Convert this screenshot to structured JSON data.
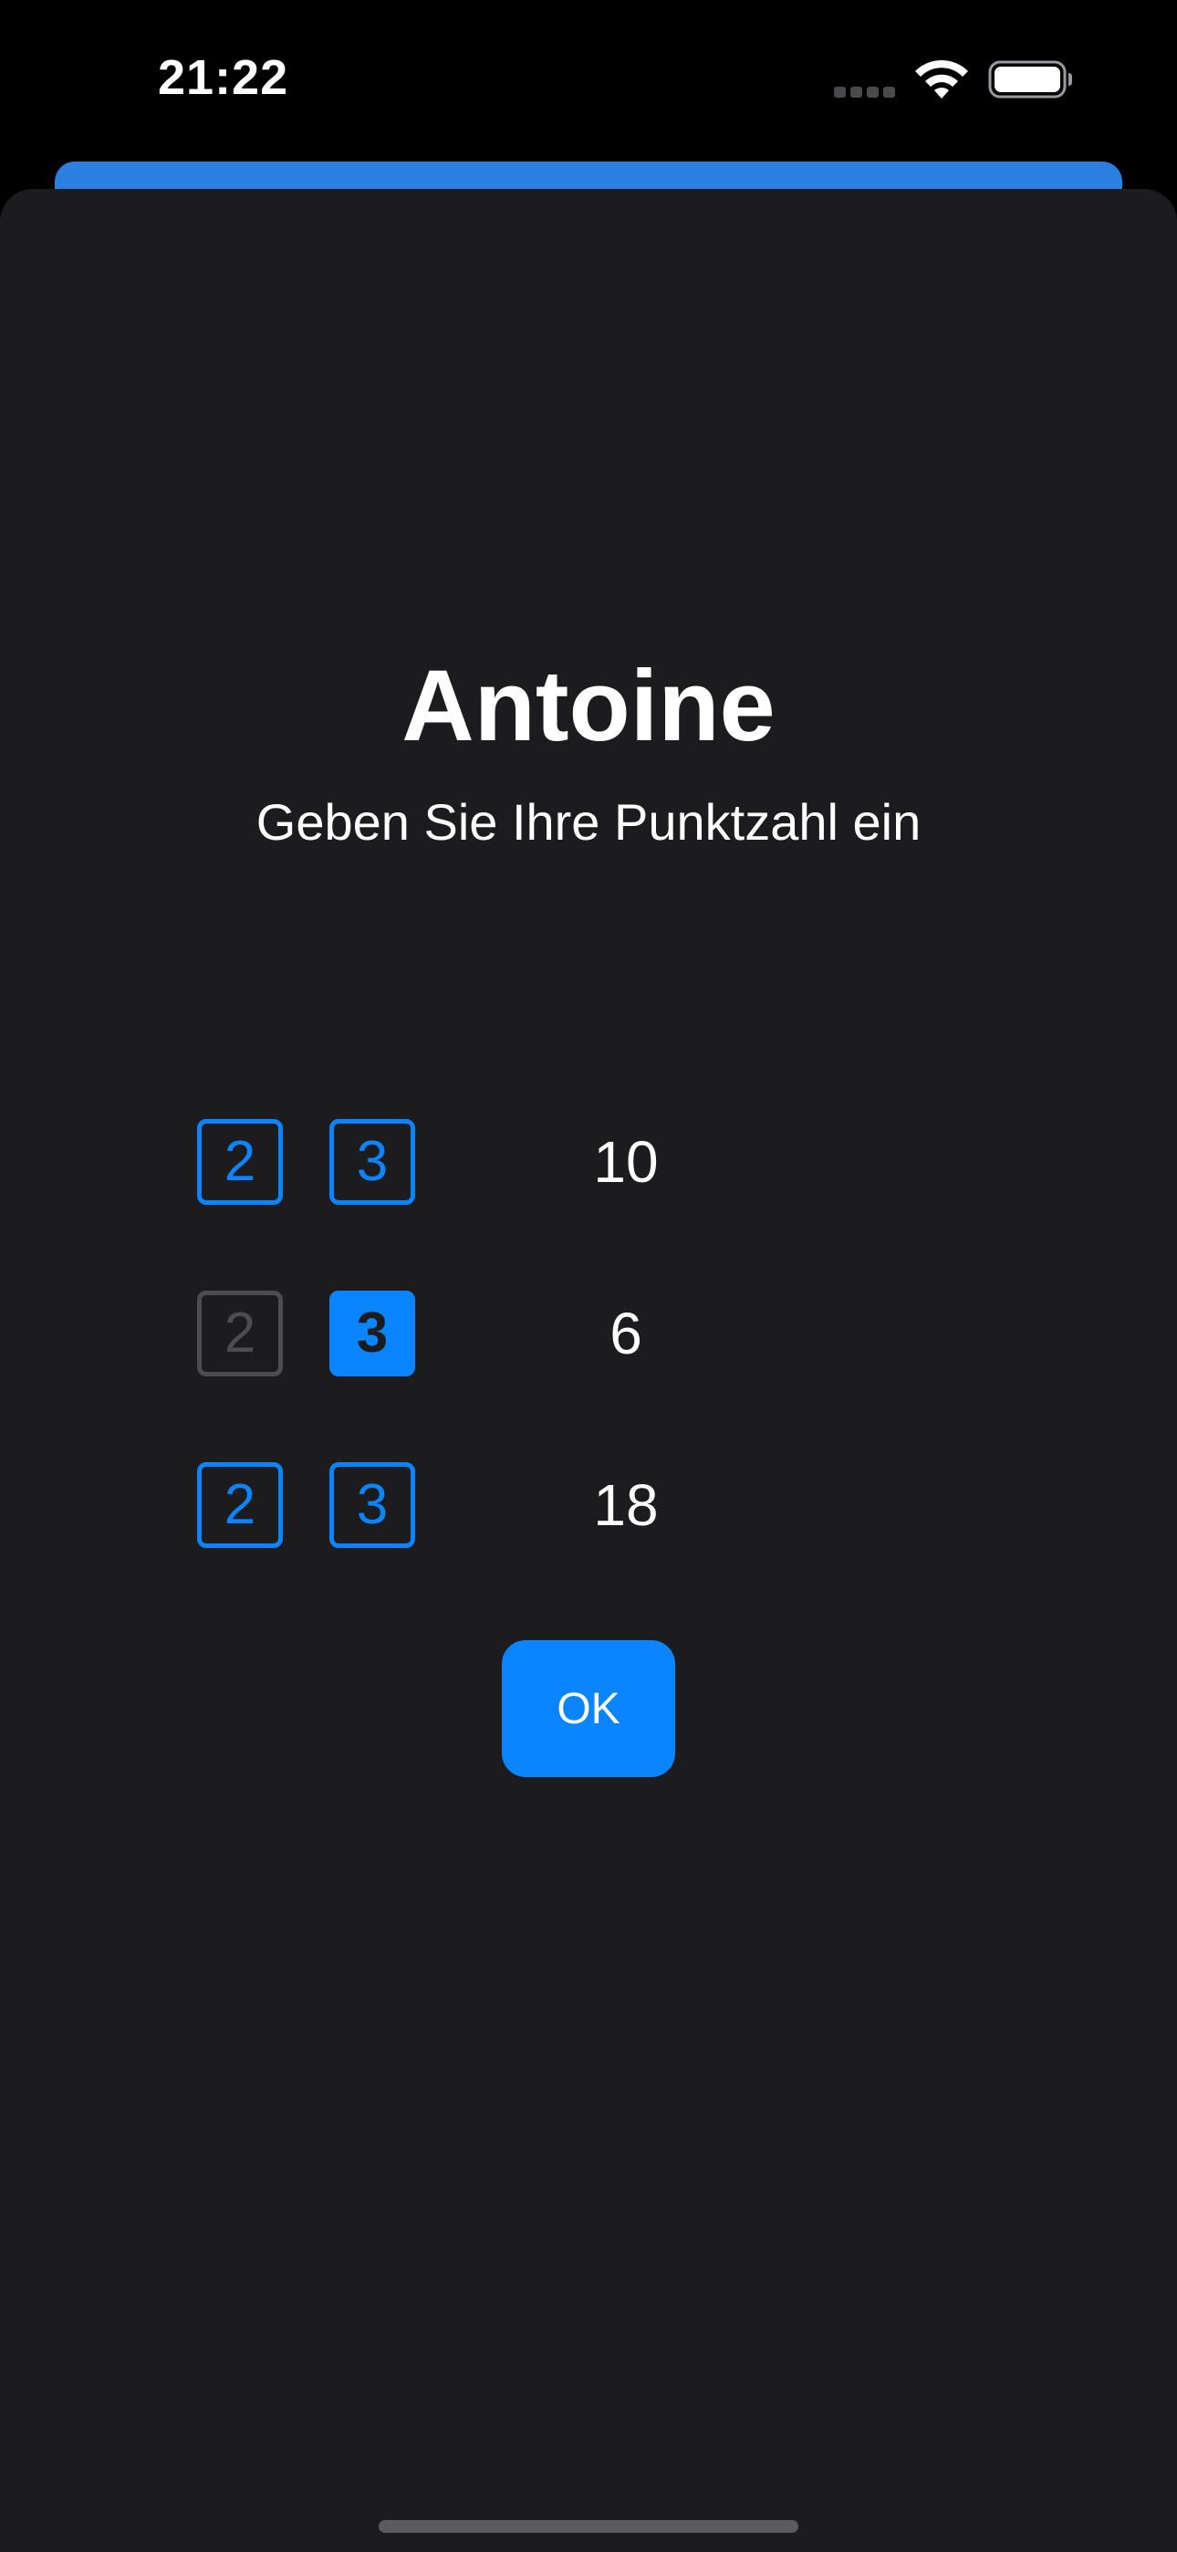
{
  "status_bar": {
    "time": "21:22",
    "icons": [
      "cellular-signal-icon",
      "wifi-icon",
      "battery-icon"
    ]
  },
  "sheet": {
    "player_name": "Antoine",
    "prompt": "Geben Sie Ihre Punktzahl ein",
    "throws": [
      {
        "double_label": "2",
        "triple_label": "3",
        "double_state": "enabled",
        "triple_state": "enabled",
        "score": "10"
      },
      {
        "double_label": "2",
        "triple_label": "3",
        "double_state": "disabled",
        "triple_state": "selected",
        "score": "6"
      },
      {
        "double_label": "2",
        "triple_label": "3",
        "double_state": "enabled",
        "triple_state": "enabled",
        "score": "18"
      }
    ],
    "ok_label": "OK"
  },
  "colors": {
    "background": "#000000",
    "sheet": "#1c1c1e",
    "accent": "#0a84ff",
    "disabled": "#4d4d50",
    "behind_card": "#2a7fe0"
  }
}
